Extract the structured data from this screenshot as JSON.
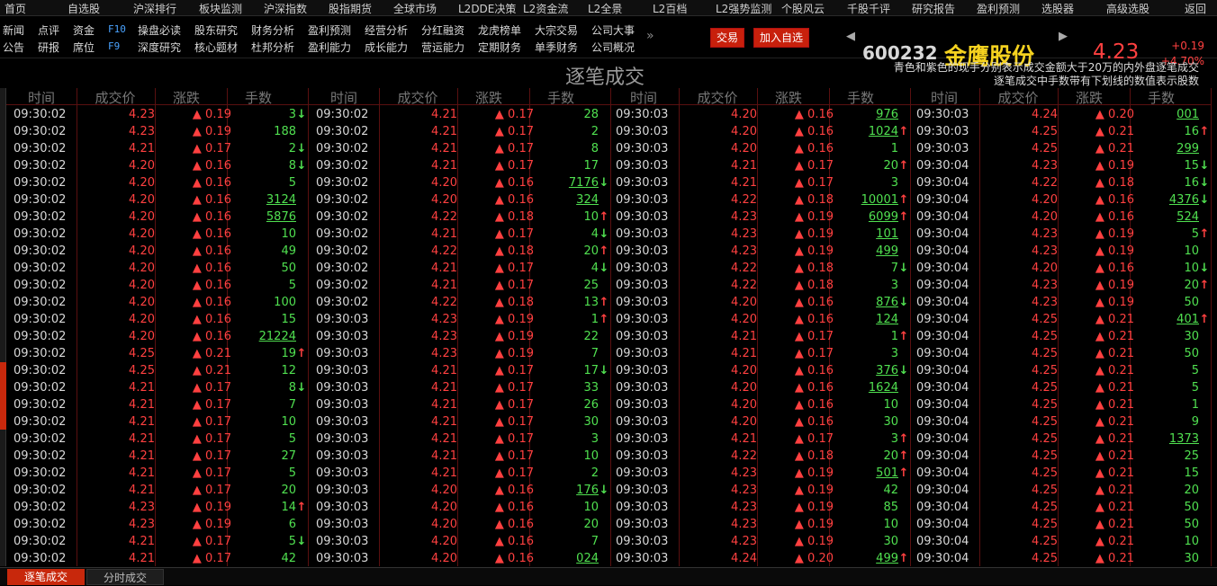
{
  "topmenu": [
    "首页",
    "自选股",
    "沪深排行",
    "板块监测",
    "沪深指数",
    "股指期货",
    "全球市场",
    "L2DDE决策",
    "L2资金流",
    "L2全景",
    "L2百档",
    "L2强势监测",
    "个股风云",
    "千股千评",
    "研究报告",
    "盈利预测",
    "选股器",
    "高级选股",
    "返回"
  ],
  "nav_row1": [
    "新闻",
    "点评",
    "资金",
    "F10",
    "操盘必读",
    "股东研究",
    "财务分析",
    "盈利预测",
    "经营分析",
    "分红融资",
    "龙虎榜单",
    "大宗交易",
    "公司大事"
  ],
  "nav_row2": [
    "公告",
    "研报",
    "席位",
    "F9",
    "深度研究",
    "核心题材",
    "杜邦分析",
    "盈利能力",
    "成长能力",
    "营运能力",
    "定期财务",
    "单季财务",
    "公司概况"
  ],
  "more": "»",
  "buttons": {
    "trade": "交易",
    "add": "加入自选"
  },
  "stock": {
    "code": "600232",
    "name": "金鹰股份",
    "price": "4.23",
    "change": "+0.19",
    "pct": "+4.70%"
  },
  "banner": {
    "title": "逐笔成交",
    "note1": "青色和紫色的现手分别表示成交金额大于20万的内外盘逐笔成交",
    "note2": "逐笔成交中手数带有下划线的数值表示股数"
  },
  "headers": [
    "时间",
    "成交价",
    "涨跌",
    "手数"
  ],
  "tabs": [
    "逐笔成交",
    "分时成交"
  ],
  "colors": {
    "up": "#ff4040",
    "down": "#50e050",
    "accent": "#c8280c",
    "name": "#f5d21f"
  },
  "columns": [
    [
      [
        "09:30:02",
        "4.23",
        "▲ 0.19",
        "3",
        "d"
      ],
      [
        "09:30:02",
        "4.23",
        "▲ 0.19",
        "188",
        ""
      ],
      [
        "09:30:02",
        "4.21",
        "▲ 0.17",
        "2",
        "d"
      ],
      [
        "09:30:02",
        "4.20",
        "▲ 0.16",
        "8",
        "d"
      ],
      [
        "09:30:02",
        "4.20",
        "▲ 0.16",
        "5",
        ""
      ],
      [
        "09:30:02",
        "4.20",
        "▲ 0.16",
        "3124",
        ""
      ],
      [
        "09:30:02",
        "4.20",
        "▲ 0.16",
        "5876",
        ""
      ],
      [
        "09:30:02",
        "4.20",
        "▲ 0.16",
        "10",
        ""
      ],
      [
        "09:30:02",
        "4.20",
        "▲ 0.16",
        "49",
        ""
      ],
      [
        "09:30:02",
        "4.20",
        "▲ 0.16",
        "50",
        ""
      ],
      [
        "09:30:02",
        "4.20",
        "▲ 0.16",
        "5",
        ""
      ],
      [
        "09:30:02",
        "4.20",
        "▲ 0.16",
        "100",
        ""
      ],
      [
        "09:30:02",
        "4.20",
        "▲ 0.16",
        "15",
        ""
      ],
      [
        "09:30:02",
        "4.20",
        "▲ 0.16",
        "21224",
        ""
      ],
      [
        "09:30:02",
        "4.25",
        "▲ 0.21",
        "19",
        "u"
      ],
      [
        "09:30:02",
        "4.25",
        "▲ 0.21",
        "12",
        ""
      ],
      [
        "09:30:02",
        "4.21",
        "▲ 0.17",
        "8",
        "d"
      ],
      [
        "09:30:02",
        "4.21",
        "▲ 0.17",
        "7",
        ""
      ],
      [
        "09:30:02",
        "4.21",
        "▲ 0.17",
        "10",
        ""
      ],
      [
        "09:30:02",
        "4.21",
        "▲ 0.17",
        "5",
        ""
      ],
      [
        "09:30:02",
        "4.21",
        "▲ 0.17",
        "27",
        ""
      ],
      [
        "09:30:02",
        "4.21",
        "▲ 0.17",
        "5",
        ""
      ],
      [
        "09:30:02",
        "4.21",
        "▲ 0.17",
        "20",
        ""
      ],
      [
        "09:30:02",
        "4.23",
        "▲ 0.19",
        "14",
        "u"
      ],
      [
        "09:30:02",
        "4.23",
        "▲ 0.19",
        "6",
        ""
      ],
      [
        "09:30:02",
        "4.21",
        "▲ 0.17",
        "5",
        "d"
      ],
      [
        "09:30:02",
        "4.21",
        "▲ 0.17",
        "42",
        ""
      ]
    ],
    [
      [
        "09:30:02",
        "4.21",
        "▲ 0.17",
        "28",
        ""
      ],
      [
        "09:30:02",
        "4.21",
        "▲ 0.17",
        "2",
        ""
      ],
      [
        "09:30:02",
        "4.21",
        "▲ 0.17",
        "8",
        ""
      ],
      [
        "09:30:02",
        "4.21",
        "▲ 0.17",
        "17",
        ""
      ],
      [
        "09:30:02",
        "4.20",
        "▲ 0.16",
        "7176",
        "d"
      ],
      [
        "09:30:02",
        "4.20",
        "▲ 0.16",
        "324",
        ""
      ],
      [
        "09:30:02",
        "4.22",
        "▲ 0.18",
        "10",
        "u"
      ],
      [
        "09:30:02",
        "4.21",
        "▲ 0.17",
        "4",
        "d"
      ],
      [
        "09:30:02",
        "4.22",
        "▲ 0.18",
        "20",
        "u"
      ],
      [
        "09:30:02",
        "4.21",
        "▲ 0.17",
        "4",
        "d"
      ],
      [
        "09:30:02",
        "4.21",
        "▲ 0.17",
        "25",
        ""
      ],
      [
        "09:30:02",
        "4.22",
        "▲ 0.18",
        "13",
        "u"
      ],
      [
        "09:30:03",
        "4.23",
        "▲ 0.19",
        "1",
        "u"
      ],
      [
        "09:30:03",
        "4.23",
        "▲ 0.19",
        "22",
        ""
      ],
      [
        "09:30:03",
        "4.23",
        "▲ 0.19",
        "7",
        ""
      ],
      [
        "09:30:03",
        "4.21",
        "▲ 0.17",
        "17",
        "d"
      ],
      [
        "09:30:03",
        "4.21",
        "▲ 0.17",
        "33",
        ""
      ],
      [
        "09:30:03",
        "4.21",
        "▲ 0.17",
        "26",
        ""
      ],
      [
        "09:30:03",
        "4.21",
        "▲ 0.17",
        "30",
        ""
      ],
      [
        "09:30:03",
        "4.21",
        "▲ 0.17",
        "3",
        ""
      ],
      [
        "09:30:03",
        "4.21",
        "▲ 0.17",
        "10",
        ""
      ],
      [
        "09:30:03",
        "4.21",
        "▲ 0.17",
        "2",
        ""
      ],
      [
        "09:30:03",
        "4.20",
        "▲ 0.16",
        "176",
        "d"
      ],
      [
        "09:30:03",
        "4.20",
        "▲ 0.16",
        "10",
        ""
      ],
      [
        "09:30:03",
        "4.20",
        "▲ 0.16",
        "20",
        ""
      ],
      [
        "09:30:03",
        "4.20",
        "▲ 0.16",
        "7",
        ""
      ],
      [
        "09:30:03",
        "4.20",
        "▲ 0.16",
        "024",
        ""
      ]
    ],
    [
      [
        "09:30:03",
        "4.20",
        "▲ 0.16",
        "976",
        ""
      ],
      [
        "09:30:03",
        "4.20",
        "▲ 0.16",
        "1024",
        "u"
      ],
      [
        "09:30:03",
        "4.20",
        "▲ 0.16",
        "1",
        ""
      ],
      [
        "09:30:03",
        "4.21",
        "▲ 0.17",
        "20",
        "u"
      ],
      [
        "09:30:03",
        "4.21",
        "▲ 0.17",
        "3",
        ""
      ],
      [
        "09:30:03",
        "4.22",
        "▲ 0.18",
        "10001",
        "u"
      ],
      [
        "09:30:03",
        "4.23",
        "▲ 0.19",
        "6099",
        "u"
      ],
      [
        "09:30:03",
        "4.23",
        "▲ 0.19",
        "101",
        ""
      ],
      [
        "09:30:03",
        "4.23",
        "▲ 0.19",
        "499",
        ""
      ],
      [
        "09:30:03",
        "4.22",
        "▲ 0.18",
        "7",
        "d"
      ],
      [
        "09:30:03",
        "4.22",
        "▲ 0.18",
        "3",
        ""
      ],
      [
        "09:30:03",
        "4.20",
        "▲ 0.16",
        "876",
        "d"
      ],
      [
        "09:30:03",
        "4.20",
        "▲ 0.16",
        "124",
        ""
      ],
      [
        "09:30:03",
        "4.21",
        "▲ 0.17",
        "1",
        "u"
      ],
      [
        "09:30:03",
        "4.21",
        "▲ 0.17",
        "3",
        ""
      ],
      [
        "09:30:03",
        "4.20",
        "▲ 0.16",
        "376",
        "d"
      ],
      [
        "09:30:03",
        "4.20",
        "▲ 0.16",
        "1624",
        ""
      ],
      [
        "09:30:03",
        "4.20",
        "▲ 0.16",
        "10",
        ""
      ],
      [
        "09:30:03",
        "4.20",
        "▲ 0.16",
        "30",
        ""
      ],
      [
        "09:30:03",
        "4.21",
        "▲ 0.17",
        "3",
        "u"
      ],
      [
        "09:30:03",
        "4.22",
        "▲ 0.18",
        "20",
        "u"
      ],
      [
        "09:30:03",
        "4.23",
        "▲ 0.19",
        "501",
        "u"
      ],
      [
        "09:30:03",
        "4.23",
        "▲ 0.19",
        "42",
        ""
      ],
      [
        "09:30:03",
        "4.23",
        "▲ 0.19",
        "85",
        ""
      ],
      [
        "09:30:03",
        "4.23",
        "▲ 0.19",
        "10",
        ""
      ],
      [
        "09:30:03",
        "4.23",
        "▲ 0.19",
        "30",
        ""
      ],
      [
        "09:30:03",
        "4.24",
        "▲ 0.20",
        "499",
        "u"
      ]
    ],
    [
      [
        "09:30:03",
        "4.24",
        "▲ 0.20",
        "001",
        ""
      ],
      [
        "09:30:03",
        "4.25",
        "▲ 0.21",
        "16",
        "u"
      ],
      [
        "09:30:03",
        "4.25",
        "▲ 0.21",
        "299",
        ""
      ],
      [
        "09:30:04",
        "4.23",
        "▲ 0.19",
        "15",
        "d"
      ],
      [
        "09:30:04",
        "4.22",
        "▲ 0.18",
        "16",
        "d"
      ],
      [
        "09:30:04",
        "4.20",
        "▲ 0.16",
        "4376",
        "d"
      ],
      [
        "09:30:04",
        "4.20",
        "▲ 0.16",
        "524",
        ""
      ],
      [
        "09:30:04",
        "4.23",
        "▲ 0.19",
        "5",
        "u"
      ],
      [
        "09:30:04",
        "4.23",
        "▲ 0.19",
        "10",
        ""
      ],
      [
        "09:30:04",
        "4.20",
        "▲ 0.16",
        "10",
        "d"
      ],
      [
        "09:30:04",
        "4.23",
        "▲ 0.19",
        "20",
        "u"
      ],
      [
        "09:30:04",
        "4.23",
        "▲ 0.19",
        "50",
        ""
      ],
      [
        "09:30:04",
        "4.25",
        "▲ 0.21",
        "401",
        "u"
      ],
      [
        "09:30:04",
        "4.25",
        "▲ 0.21",
        "30",
        ""
      ],
      [
        "09:30:04",
        "4.25",
        "▲ 0.21",
        "50",
        ""
      ],
      [
        "09:30:04",
        "4.25",
        "▲ 0.21",
        "5",
        ""
      ],
      [
        "09:30:04",
        "4.25",
        "▲ 0.21",
        "5",
        ""
      ],
      [
        "09:30:04",
        "4.25",
        "▲ 0.21",
        "1",
        ""
      ],
      [
        "09:30:04",
        "4.25",
        "▲ 0.21",
        "9",
        ""
      ],
      [
        "09:30:04",
        "4.25",
        "▲ 0.21",
        "1373",
        ""
      ],
      [
        "09:30:04",
        "4.25",
        "▲ 0.21",
        "25",
        ""
      ],
      [
        "09:30:04",
        "4.25",
        "▲ 0.21",
        "15",
        ""
      ],
      [
        "09:30:04",
        "4.25",
        "▲ 0.21",
        "20",
        ""
      ],
      [
        "09:30:04",
        "4.25",
        "▲ 0.21",
        "50",
        ""
      ],
      [
        "09:30:04",
        "4.25",
        "▲ 0.21",
        "50",
        ""
      ],
      [
        "09:30:04",
        "4.25",
        "▲ 0.21",
        "10",
        ""
      ],
      [
        "09:30:04",
        "4.25",
        "▲ 0.21",
        "30",
        ""
      ]
    ]
  ]
}
